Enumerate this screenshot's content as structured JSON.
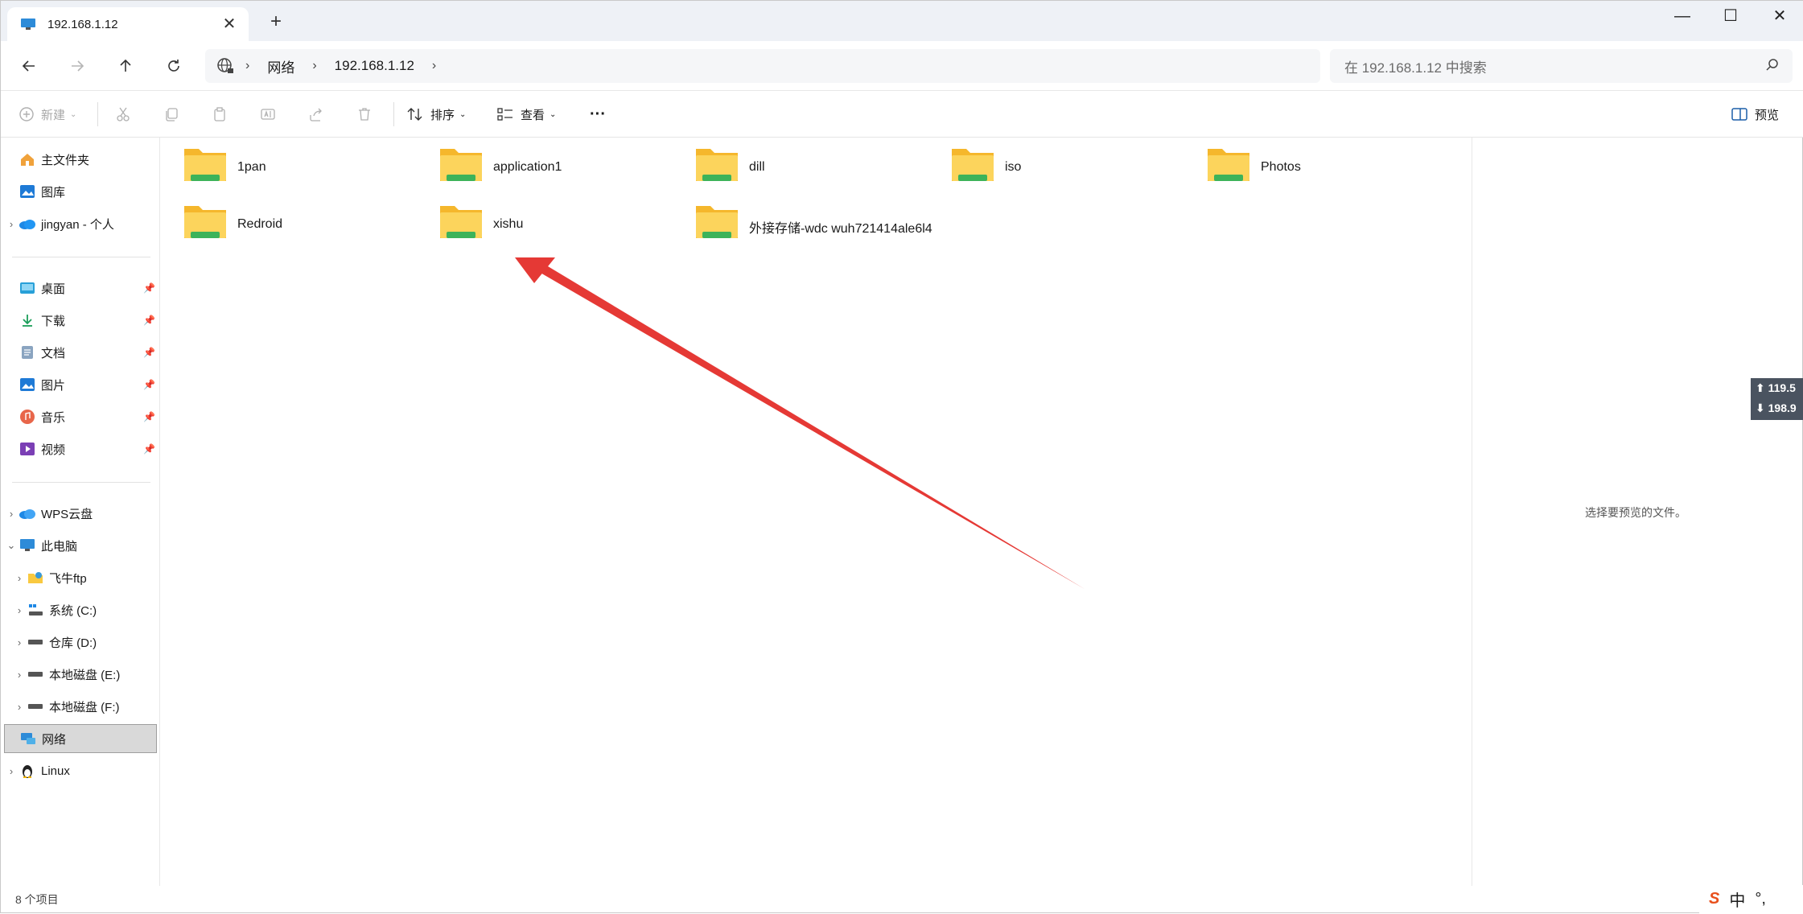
{
  "tab": {
    "title": "192.168.1.12",
    "close": "✕",
    "new_tab": "+",
    "icon": "pc-icon"
  },
  "window_controls": {
    "minimize": "—",
    "maximize": "☐",
    "close": "✕"
  },
  "address": {
    "segments": [
      "网络",
      "192.168.1.12"
    ],
    "icon": "network-globe-icon"
  },
  "search": {
    "placeholder": "在 192.168.1.12 中搜索"
  },
  "toolbar": {
    "new_label": "新建",
    "sort_label": "排序",
    "view_label": "查看",
    "more_label": "···",
    "preview_label": "预览"
  },
  "sidebar": {
    "quick": [
      {
        "label": "主文件夹",
        "icon": "home-icon"
      },
      {
        "label": "图库",
        "icon": "gallery-icon"
      },
      {
        "label": "jingyan - 个人",
        "icon": "onedrive-cloud-icon",
        "expandable": true
      }
    ],
    "pinned": [
      {
        "label": "桌面",
        "icon": "desktop-icon"
      },
      {
        "label": "下载",
        "icon": "download-icon"
      },
      {
        "label": "文档",
        "icon": "document-icon"
      },
      {
        "label": "图片",
        "icon": "pictures-icon"
      },
      {
        "label": "音乐",
        "icon": "music-icon"
      },
      {
        "label": "视频",
        "icon": "video-icon"
      }
    ],
    "devices": [
      {
        "label": "WPS云盘",
        "icon": "wps-cloud-icon"
      },
      {
        "label": "此电脑",
        "icon": "pc-icon"
      },
      {
        "label": "飞牛ftp",
        "icon": "ftp-folder-icon"
      },
      {
        "label": "系统 (C:)",
        "icon": "windows-drive-icon"
      },
      {
        "label": "仓库 (D:)",
        "icon": "drive-icon"
      },
      {
        "label": "本地磁盘 (E:)",
        "icon": "drive-icon"
      },
      {
        "label": "本地磁盘 (F:)",
        "icon": "drive-icon"
      },
      {
        "label": "网络",
        "icon": "network-icon",
        "selected": true
      },
      {
        "label": "Linux",
        "icon": "linux-penguin-icon"
      }
    ]
  },
  "folders": [
    {
      "name": "1pan"
    },
    {
      "name": "application1"
    },
    {
      "name": "dill"
    },
    {
      "name": "iso"
    },
    {
      "name": "Photos"
    },
    {
      "name": "Redroid"
    },
    {
      "name": "xishu"
    },
    {
      "name": "外接存储-wdc wuh721414ale6l4"
    }
  ],
  "preview_pane": {
    "message": "选择要预览的文件。"
  },
  "status": {
    "item_count": "8 个项目"
  },
  "net_monitor": {
    "up": "119.5",
    "down": "198.9"
  },
  "ime": {
    "logo": "S",
    "mode": "中",
    "punct": "°,"
  },
  "colors": {
    "folder": "#f9c940",
    "folder_share": "#3cb35a",
    "arrow": "#e53935",
    "selection": "#d9d9d9"
  }
}
